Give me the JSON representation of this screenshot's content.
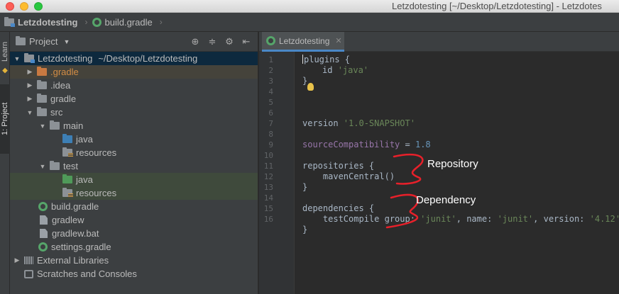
{
  "window": {
    "title": "Letzdotesting [~/Desktop/Letzdotesting] - Letzdotes"
  },
  "breadcrumb": {
    "project": "Letzdotesting",
    "file": "build.gradle"
  },
  "toolstrip": {
    "learn": "Learn",
    "project": "1: Project"
  },
  "project_panel": {
    "title": "Project",
    "root_name": "Letzdotesting",
    "root_path": "~/Desktop/Letzdotesting",
    "items": {
      "gradle_hidden": ".gradle",
      "idea": ".idea",
      "gradle": "gradle",
      "src": "src",
      "main": "main",
      "main_java": "java",
      "main_resources": "resources",
      "test": "test",
      "test_java": "java",
      "test_resources": "resources",
      "build_gradle": "build.gradle",
      "gradlew": "gradlew",
      "gradlew_bat": "gradlew.bat",
      "settings_gradle": "settings.gradle",
      "external_libraries": "External Libraries",
      "scratches": "Scratches and Consoles"
    }
  },
  "editor": {
    "tab_label": "Letzdotesting",
    "line_numbers": [
      "1",
      "2",
      "3",
      "4",
      "5",
      "6",
      "7",
      "8",
      "9",
      "10",
      "11",
      "12",
      "13",
      "14",
      "15",
      "16"
    ],
    "code": {
      "l1": "plugins {",
      "l2_id": "id ",
      "l2_str": "'java'",
      "l3": "}",
      "l5_kw": "version ",
      "l5_str": "'1.0-SNAPSHOT'",
      "l7_prop": "sourceCompatibility",
      "l7_eq": " = ",
      "l7_num": "1.8",
      "l9": "repositories {",
      "l10": "    mavenCentral()",
      "l11": "}",
      "l13": "dependencies {",
      "l14_fn": "    testCompile ",
      "l14_group": "group: ",
      "l14_g": "'junit'",
      "l14_c1": ", ",
      "l14_name": "name: ",
      "l14_n": "'junit'",
      "l14_c2": ", ",
      "l14_version": "version: ",
      "l14_v": "'4.12'",
      "l15": "}"
    },
    "annotations": {
      "repository": "Repository",
      "dependency": "Dependency"
    }
  },
  "colors": {
    "annotation_stroke": "#e8202a",
    "selection": "#0d293e"
  }
}
